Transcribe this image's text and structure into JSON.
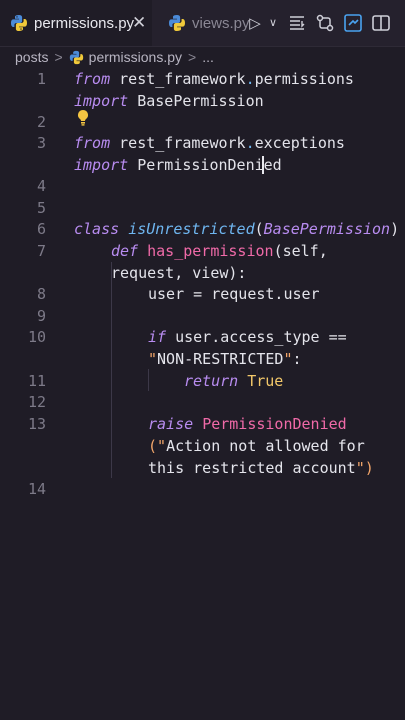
{
  "tabs": [
    {
      "label": "permissions.py",
      "active": true
    },
    {
      "label": "views.py",
      "active": false
    }
  ],
  "toolbar": {
    "close_glyph": "✕",
    "run_glyph": "▷",
    "dropdown_glyph": "∨"
  },
  "breadcrumb": {
    "folder": "posts",
    "sep": ">",
    "file": "permissions.py",
    "more": "..."
  },
  "lines": [
    {
      "n": "1"
    },
    {
      "n": "2"
    },
    {
      "n": "3"
    },
    {
      "n": "4"
    },
    {
      "n": "5"
    },
    {
      "n": "6"
    },
    {
      "n": "7"
    },
    {
      "n": "8"
    },
    {
      "n": "9"
    },
    {
      "n": "10"
    },
    {
      "n": "11"
    },
    {
      "n": "12"
    },
    {
      "n": "13"
    },
    {
      "n": "14"
    }
  ],
  "code": {
    "l1a_kw": "from",
    "l1a_rest": " rest_framework",
    "l1a_dot": ".",
    "l1a_mod": "permissions",
    "l1b_kw": "import",
    "l1b_rest": " BasePermission",
    "l3a_kw": "from",
    "l3a_rest": " rest_framework",
    "l3a_dot": ".",
    "l3a_mod": "exceptions",
    "l3b_kw": "import",
    "l3b_rest": " PermissionDenied",
    "l6_kw": "class",
    "l6_cls": "isUnrestricted",
    "l6_p1": "(",
    "l6_base": "BasePermission",
    "l6_p2": ")",
    "l7_kw": "def",
    "l7_fn": "has_permission",
    "l7_args": "(self,",
    "l7b_args": "request, view):",
    "l8_code": "user = request.user",
    "l10_kw": "if",
    "l10_rest": " user.access_type ==",
    "l10b_q1": "\"",
    "l10b_str": "NON-RESTRICTED",
    "l10b_q2": "\"",
    "l10b_colon": ":",
    "l11_kw": "return",
    "l11_val": "True",
    "l13_kw": "raise",
    "l13_err": "PermissionDenied",
    "l13b_p": "(",
    "l13b_q": "\"",
    "l13b_str": "Action not allowed for",
    "l13c_str": "this restricted account",
    "l13c_q": "\"",
    "l13c_p": ")"
  }
}
